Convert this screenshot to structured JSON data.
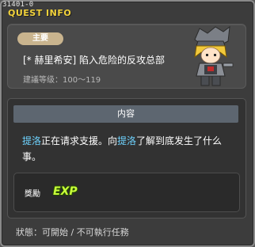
{
  "window": {
    "quest_id": "31401-0",
    "title": "QUEST INFO"
  },
  "header": {
    "badge": "主要",
    "quest_name": "[* 赫里希安] 陷入危险的反攻总部",
    "level_range": "建議等级：100～119",
    "avatar_icon": "character-avatar-icon"
  },
  "content": {
    "tab_label": "内容",
    "text_part1": "提洛",
    "text_part2": "正在请求支援。向",
    "text_part3": "提洛",
    "text_part4": "了解到底发生了什么事。",
    "highlight_color": "#6ed3ff"
  },
  "reward": {
    "label": "獎勵",
    "exp_label": "EXP"
  },
  "status": {
    "text": "狀態：可開始 / 不可執行任務"
  }
}
